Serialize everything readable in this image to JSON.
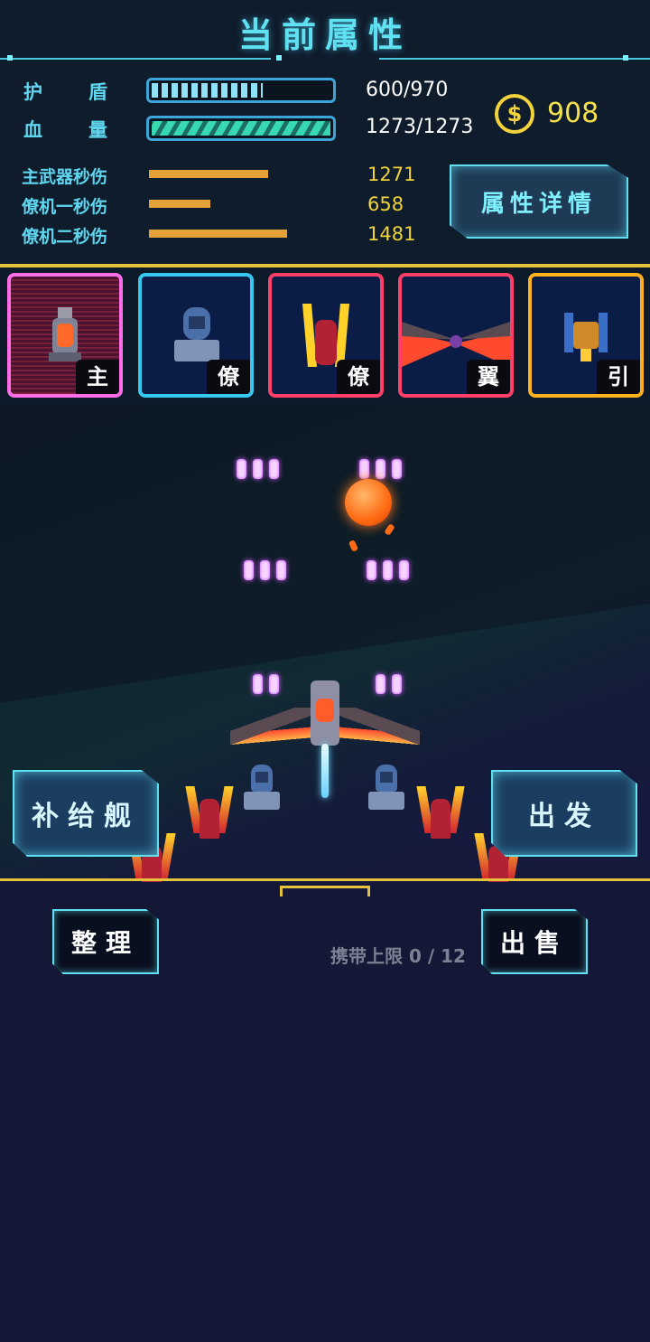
{
  "header": {
    "title": "当前属性"
  },
  "stats": {
    "shield": {
      "label_a": "护",
      "label_b": "盾",
      "value": "600/970",
      "fill": 0.62
    },
    "hp": {
      "label_a": "血",
      "label_b": "量",
      "value": "1273/1273",
      "fill": 1.0
    }
  },
  "coins": {
    "icon": "coin-icon",
    "value": "908"
  },
  "dps": [
    {
      "label": "主武器秒伤",
      "value": "1271"
    },
    {
      "label": "僚机一秒伤",
      "value": "658"
    },
    {
      "label": "僚机二秒伤",
      "value": "1481"
    }
  ],
  "detail_button": "属性详情",
  "slots": [
    {
      "tag": "主",
      "color": "#ff6ee8"
    },
    {
      "tag": "僚",
      "color": "#36c8ef"
    },
    {
      "tag": "僚",
      "color": "#ff3e6a"
    },
    {
      "tag": "翼",
      "color": "#ff3e6a"
    },
    {
      "tag": "引",
      "color": "#ffb21e"
    }
  ],
  "buttons": {
    "supply": "补给舰",
    "launch": "出发",
    "sort": "整理",
    "sell": "出售"
  },
  "capacity": "携带上限 0 / 12",
  "colors": {
    "accent": "#5fe1f2",
    "gold": "#e6c23a",
    "coin": "#f3d33a"
  }
}
